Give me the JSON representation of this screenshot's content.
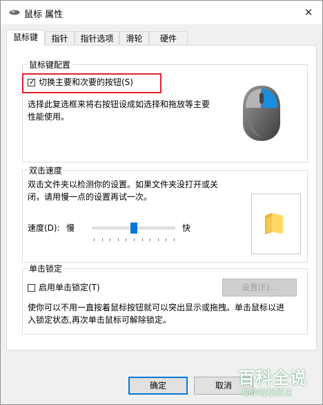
{
  "window": {
    "title": "鼠标 属性",
    "close_glyph": "✕"
  },
  "tabs": [
    {
      "label": "鼠标键",
      "active": true
    },
    {
      "label": "指针",
      "active": false
    },
    {
      "label": "指针选项",
      "active": false
    },
    {
      "label": "滑轮",
      "active": false
    },
    {
      "label": "硬件",
      "active": false
    }
  ],
  "button_config": {
    "group_label": "鼠标键配置",
    "switch_checkbox": {
      "label": "切换主要和次要的按钮(S)",
      "checked": true
    },
    "description_line1": "选择此复选框来将右按钮设成如选择和拖放等主要",
    "description_line2": "性能使用。"
  },
  "double_click": {
    "group_label": "双击速度",
    "description_line1": "双击文件夹以检测你的设置。如果文件夹没打开或关",
    "description_line2": "闭，请用慢一点的设置再试一次。",
    "speed_label": "速度(D):",
    "slow_label": "慢",
    "fast_label": "快",
    "speed_fraction": 0.5
  },
  "click_lock": {
    "group_label": "单击锁定",
    "checkbox": {
      "label": "启用单击锁定(T)",
      "checked": false
    },
    "settings_button": "设置(E)...",
    "description_line1": "使你可以不用一直按着鼠标按钮就可以突出显示或拖拽。单击鼠标以进",
    "description_line2": "入锁定状态,再次单击鼠标可解除锁定。"
  },
  "footer": {
    "ok_label": "确定",
    "cancel_label": "取消"
  },
  "watermark": {
    "line1": "百科全说",
    "line2": "助你轻松解决"
  },
  "colors": {
    "accent": "#0078d7",
    "highlight_box": "#e0202e"
  }
}
